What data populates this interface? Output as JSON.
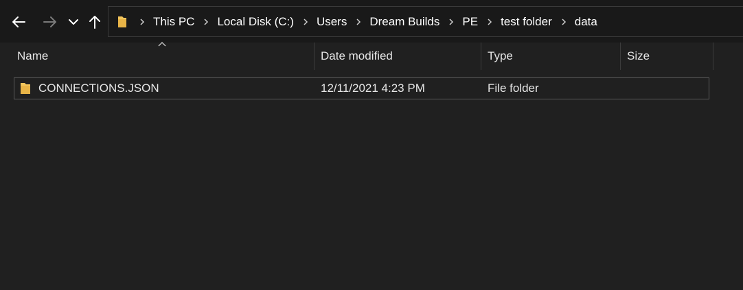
{
  "toolbar": {
    "back_icon": "arrow-left-icon",
    "forward_icon": "arrow-right-icon",
    "recent_icon": "chevron-down-icon",
    "up_icon": "arrow-up-icon"
  },
  "breadcrumb": {
    "folder_icon": "folder-icon",
    "separator_icon": "chevron-right-icon",
    "items": [
      "This PC",
      "Local Disk (C:)",
      "Users",
      "Dream Builds",
      "PE",
      "test folder",
      "data"
    ]
  },
  "columns": {
    "name": "Name",
    "date_modified": "Date modified",
    "type": "Type",
    "size": "Size",
    "sort_indicator_icon": "caret-up-icon"
  },
  "files": [
    {
      "icon": "folder-icon",
      "name": "CONNECTIONS.JSON",
      "date_modified": "12/11/2021 4:23 PM",
      "type": "File folder",
      "size": ""
    }
  ],
  "colors": {
    "background": "#202020",
    "toolbar": "#191919",
    "text": "#ffffff",
    "folder": "#f2c55c",
    "selection_border": "#5c5c5c"
  }
}
